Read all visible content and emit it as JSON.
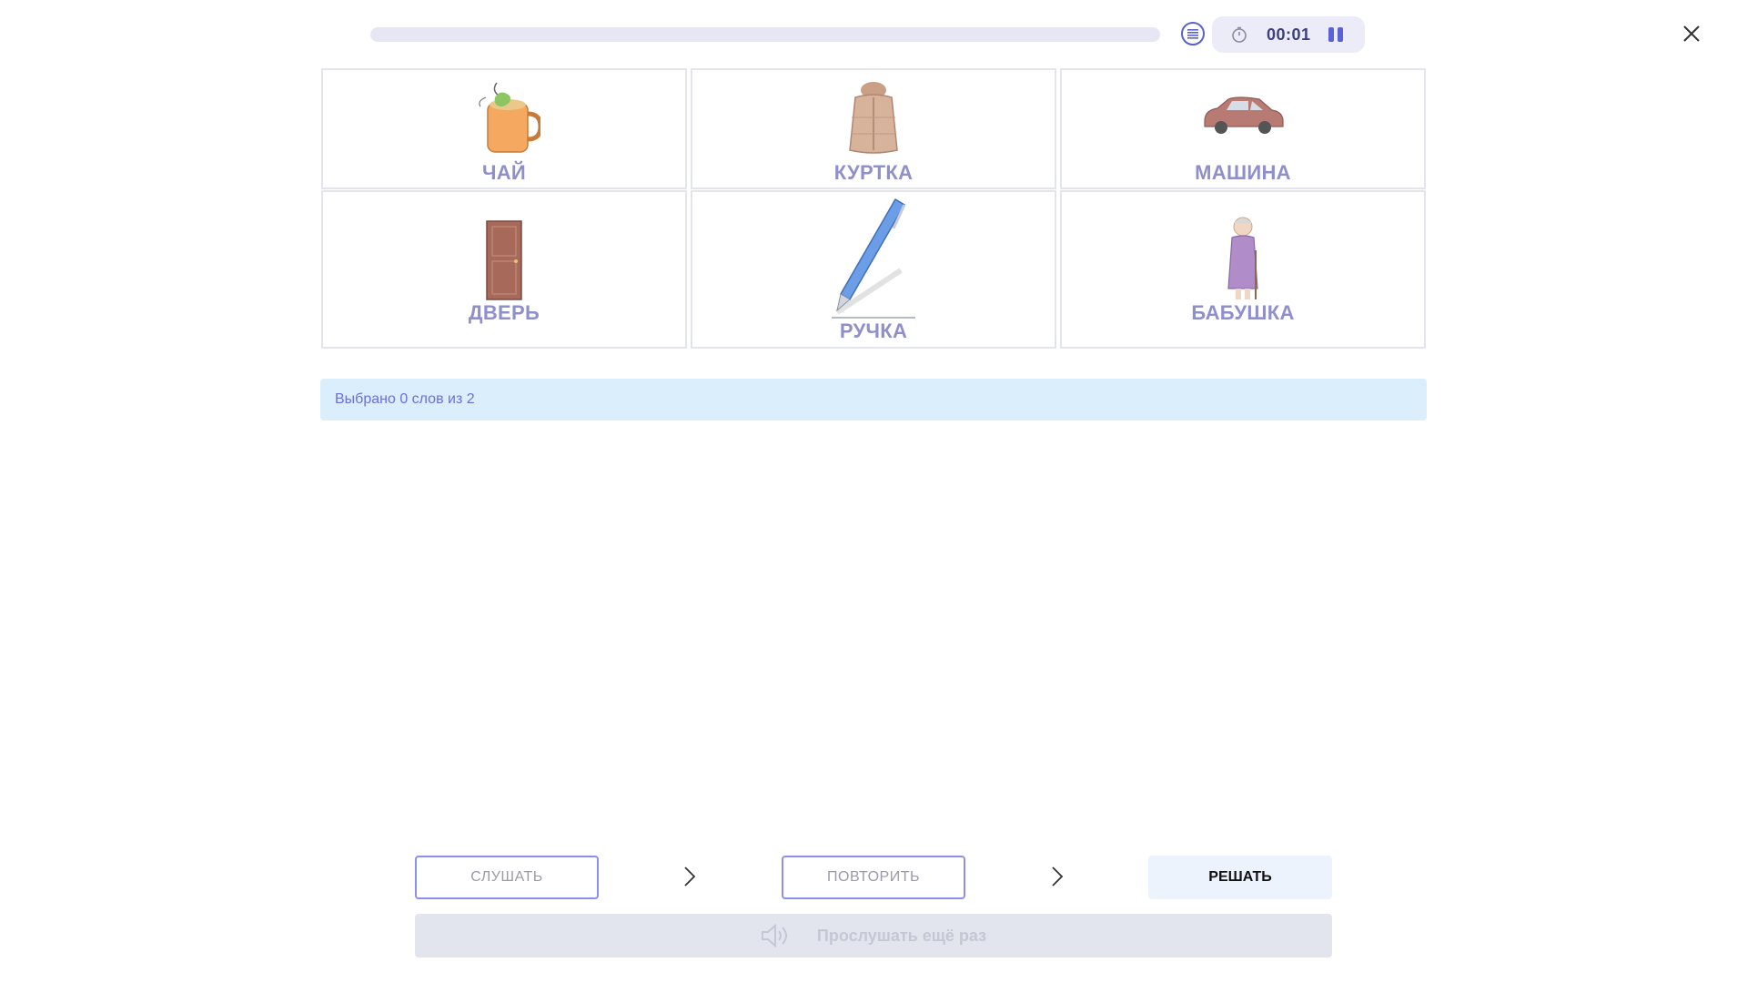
{
  "timer": {
    "value": "00:01"
  },
  "progress": {
    "fraction": 0
  },
  "cards": [
    {
      "label": "ЧАЙ",
      "icon": "tea-cup-icon"
    },
    {
      "label": "КУРТКА",
      "icon": "jacket-icon"
    },
    {
      "label": "МАШИНА",
      "icon": "car-icon"
    },
    {
      "label": "ДВЕРЬ",
      "icon": "door-icon"
    },
    {
      "label": "РУЧКА",
      "icon": "pen-icon"
    },
    {
      "label": "БАБУШКА",
      "icon": "grandmother-icon"
    }
  ],
  "status": {
    "text": "Выбрано 0 слов из 2"
  },
  "steps": {
    "listen_label": "СЛУШАТЬ",
    "repeat_label": "ПОВТОРИТЬ",
    "solve_label": "РЕШАТЬ"
  },
  "replay": {
    "label": "Прослушать ещё раз"
  },
  "colors": {
    "accent": "#5a62d8",
    "card_label": "#8f8fcc",
    "status_bg": "#daeefc",
    "status_text": "#6a6fe0"
  }
}
